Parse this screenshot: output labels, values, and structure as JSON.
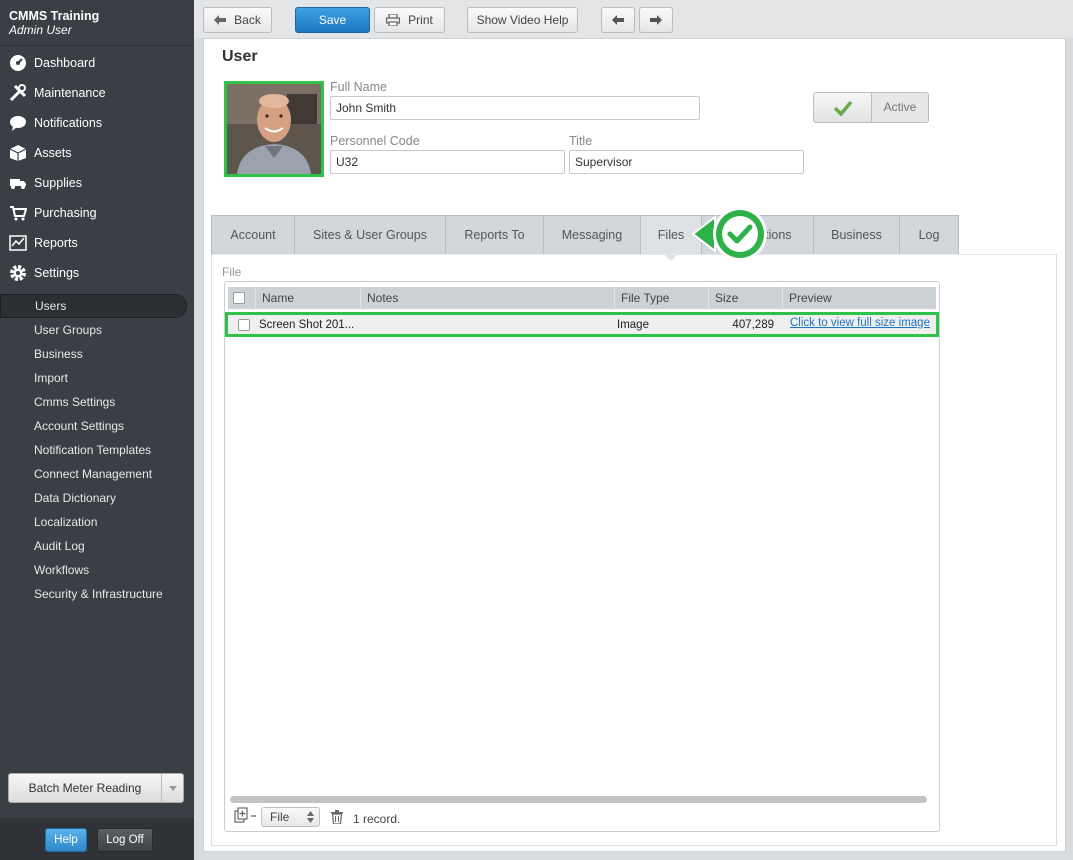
{
  "app": {
    "name": "CMMS Training",
    "user": "Admin User"
  },
  "nav": [
    {
      "label": "Dashboard",
      "icon": "dashboard-icon"
    },
    {
      "label": "Maintenance",
      "icon": "tools-icon"
    },
    {
      "label": "Notifications",
      "icon": "speech-bubble-icon"
    },
    {
      "label": "Assets",
      "icon": "boxes-icon"
    },
    {
      "label": "Supplies",
      "icon": "truck-icon"
    },
    {
      "label": "Purchasing",
      "icon": "cart-icon"
    },
    {
      "label": "Reports",
      "icon": "chart-icon"
    },
    {
      "label": "Settings",
      "icon": "gear-icon"
    }
  ],
  "subnav": [
    "Users",
    "User Groups",
    "Business",
    "Import",
    "Cmms Settings",
    "Account Settings",
    "Notification Templates",
    "Connect Management",
    "Data Dictionary",
    "Localization",
    "Audit Log",
    "Workflows",
    "Security & Infrastructure"
  ],
  "sidebar_footer": {
    "batch": "Batch Meter Reading",
    "help": "Help",
    "logoff": "Log Off"
  },
  "toolbar": {
    "back": "Back",
    "save": "Save",
    "print": "Print",
    "video_help": "Show Video Help"
  },
  "form": {
    "title": "User",
    "full_name_label": "Full Name",
    "full_name": "John Smith",
    "personnel_code_label": "Personnel Code",
    "personnel_code": "U32",
    "title_label": "Title",
    "title_value": "Supervisor",
    "active_label": "Active"
  },
  "tabs": [
    "Account",
    "Sites & User Groups",
    "Reports To",
    "Messaging",
    "Files",
    "Notifications",
    "Business",
    "Log"
  ],
  "active_tab": "Files",
  "files": {
    "section_label": "File",
    "columns": [
      "Name",
      "Notes",
      "File Type",
      "Size",
      "Preview"
    ],
    "rows": [
      {
        "name": "Screen Shot 201...",
        "notes": "",
        "type": "Image",
        "size": "407,289",
        "preview": "Click to view full size image"
      }
    ],
    "file_select": "File",
    "record_count": "1 record."
  },
  "colors": {
    "highlight": "#2ec24a",
    "primary": "#1d78c1",
    "sidebar": "#3a3f45"
  }
}
